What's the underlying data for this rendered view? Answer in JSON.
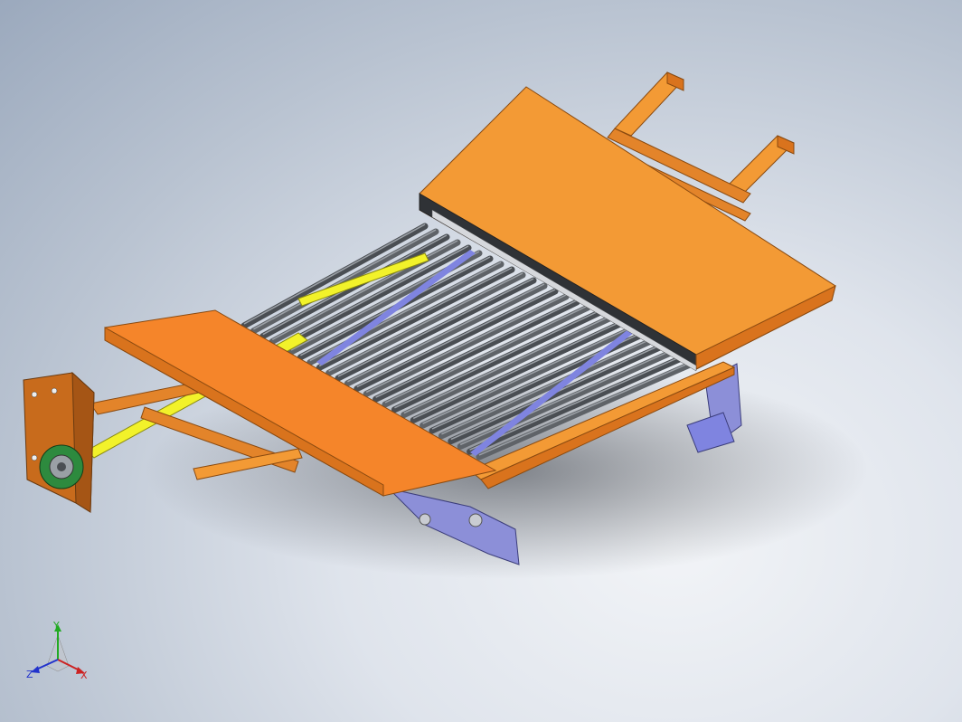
{
  "window": {
    "title": ""
  },
  "viewport": {
    "background_top": "#9ba9bd",
    "background_bottom": "#f2f4f7"
  },
  "model": {
    "colors": {
      "frame_orange": "#f39a35",
      "frame_orange_dark": "#d9731d",
      "frame_orange_light": "#f7ad5a",
      "roller_gray": "#5f6368",
      "roller_gray_light": "#8b9096",
      "shaft_yellow": "#f2f22a",
      "bracket_purple": "#8c8fd8",
      "guide_blue": "#7f84e0",
      "gear_green": "#2d8a3e"
    }
  },
  "triad": {
    "x_label": "X",
    "y_label": "Y",
    "z_label": "Z",
    "x_color": "#cc2222",
    "y_color": "#22aa22",
    "z_color": "#2233cc"
  }
}
